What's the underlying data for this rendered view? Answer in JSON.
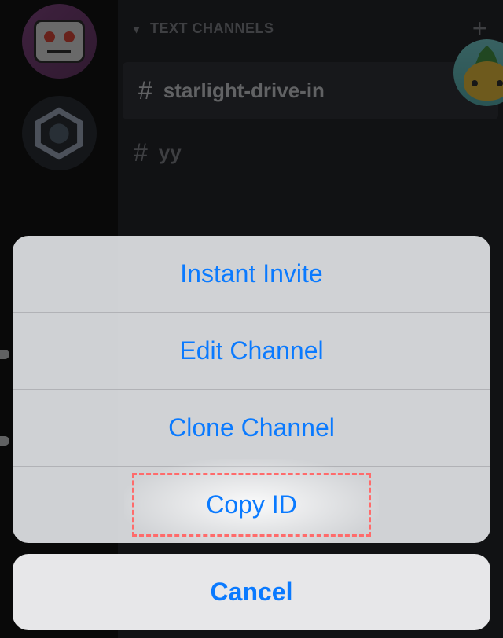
{
  "channels": {
    "header": "TEXT CHANNELS",
    "items": [
      {
        "name": "starlight-drive-in",
        "active": true
      },
      {
        "name": "yy",
        "active": false
      }
    ]
  },
  "action_sheet": {
    "options": [
      {
        "label": "Instant Invite"
      },
      {
        "label": "Edit Channel"
      },
      {
        "label": "Clone Channel"
      },
      {
        "label": "Copy ID",
        "highlighted": true
      }
    ],
    "cancel_label": "Cancel"
  },
  "colors": {
    "action_text": "#0a7aff",
    "highlight_border": "#ff6b6b"
  }
}
